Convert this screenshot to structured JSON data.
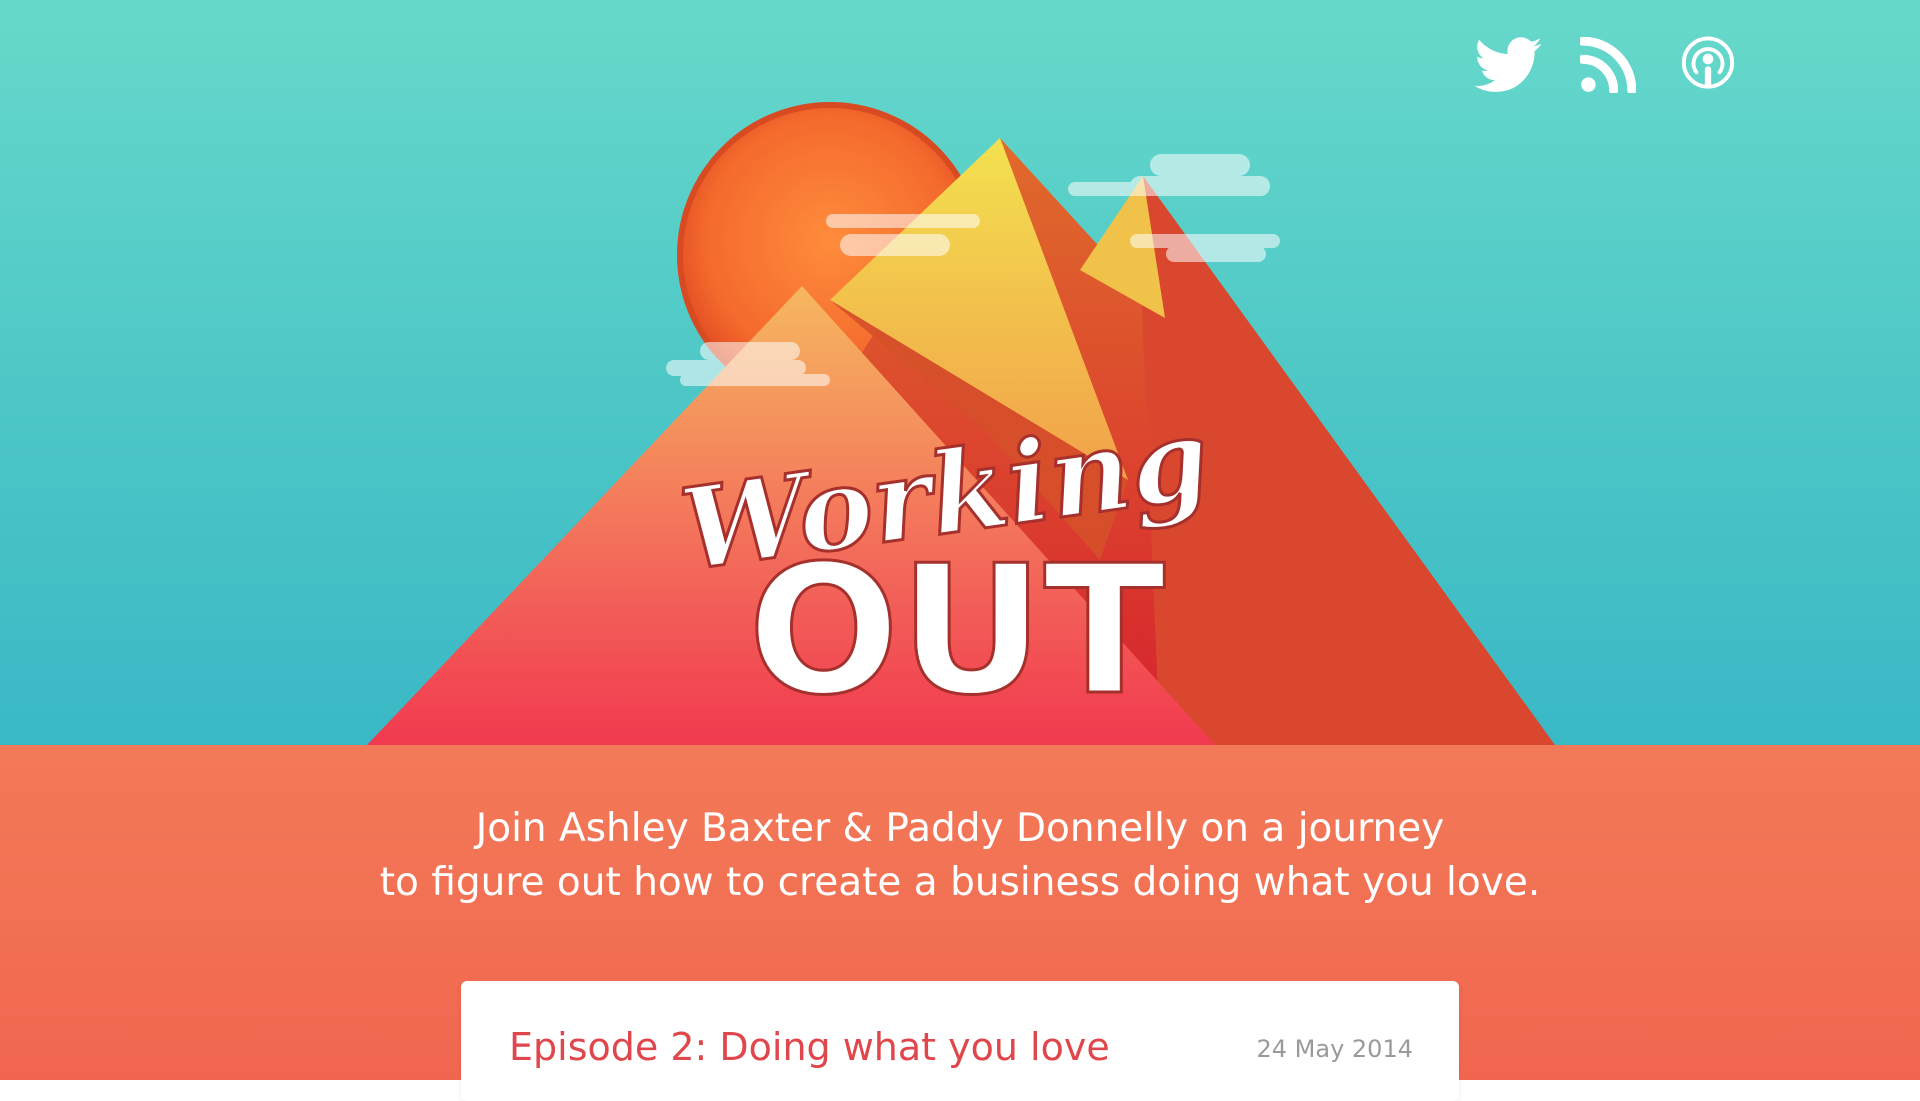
{
  "social": {
    "twitter_icon": "twitter-icon",
    "rss_icon": "rss-icon",
    "podcast_icon": "podcast-icon"
  },
  "logo": {
    "script_text": "Working",
    "block_text": "OUT"
  },
  "tagline": {
    "line1": "Join Ashley Baxter & Paddy Donnelly on a journey",
    "line2": "to figure out how to create a business doing what you love."
  },
  "episode": {
    "title": "Episode 2: Doing what you love",
    "date": "24 May 2014"
  },
  "colors": {
    "sky_top": "#67d9cb",
    "sky_bottom": "#3ab8c6",
    "ground": "#f37a58",
    "episode_title": "#e0474c",
    "sun": "#f56a32"
  }
}
